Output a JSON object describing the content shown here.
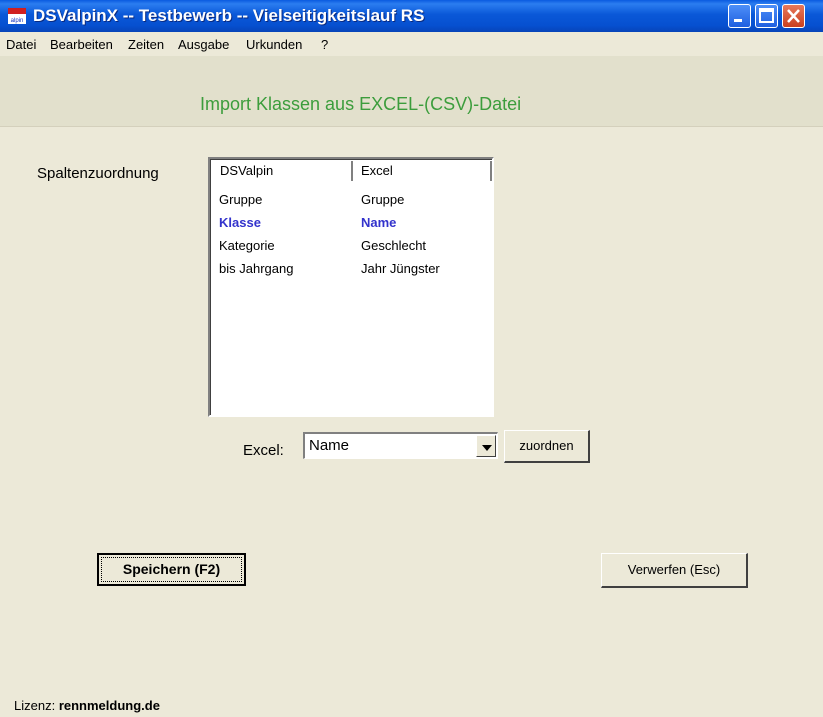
{
  "window": {
    "title": "DSValpinX -- Testbewerb -- Vielseitigkeitslauf RS",
    "icon_name": "dsvalpin-app-icon",
    "icon_text": "alpin"
  },
  "menu": [
    "Datei",
    "Bearbeiten",
    "Zeiten",
    "Ausgabe",
    "Urkunden",
    "?"
  ],
  "dialog": {
    "title": "Import Klassen aus EXCEL-(CSV)-Datei",
    "column_mapping_label": "Spaltenzuordnung",
    "columns": [
      "DSValpin",
      "Excel"
    ],
    "rows": [
      {
        "dsvalpin": "Gruppe",
        "excel": "Gruppe",
        "selected": false
      },
      {
        "dsvalpin": "Klasse",
        "excel": "Name",
        "selected": true
      },
      {
        "dsvalpin": "Kategorie",
        "excel": "Geschlecht",
        "selected": false
      },
      {
        "dsvalpin": "bis Jahrgang",
        "excel": "Jahr Jüngster",
        "selected": false
      }
    ],
    "excel_label": "Excel:",
    "excel_value": "Name",
    "assign_button": "zuordnen",
    "save_button": "Speichern (F2)",
    "discard_button": "Verwerfen (Esc)"
  },
  "status": {
    "license_label": "Lizenz:",
    "license_value": "rennmeldung.de"
  },
  "colors": {
    "title_accent": "#3c9d3c",
    "selected_row": "#3333cc",
    "background": "#ece9d8",
    "titlebar": "#0a58d8"
  }
}
